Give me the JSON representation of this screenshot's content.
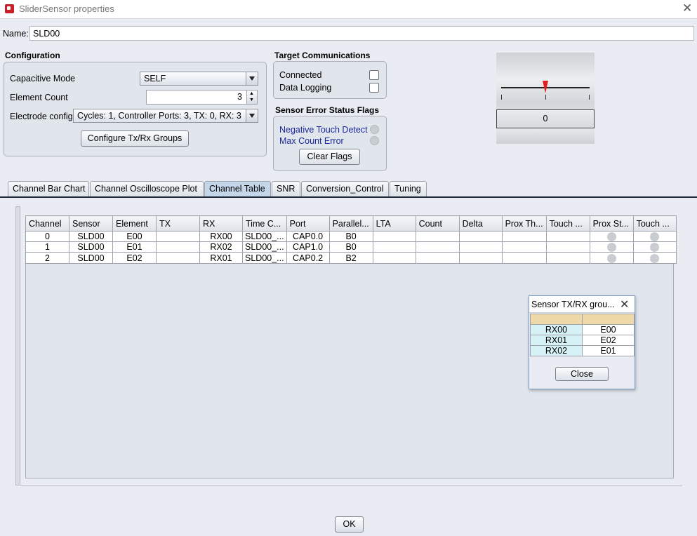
{
  "window": {
    "title": "SliderSensor properties"
  },
  "name_row": {
    "label": "Name:",
    "value": "SLD00"
  },
  "configuration": {
    "title": "Configuration",
    "capacitive_mode_label": "Capacitive Mode",
    "capacitive_mode_value": "SELF",
    "element_count_label": "Element Count",
    "element_count_value": "3",
    "electrode_config_label": "Electrode config",
    "electrode_config_value": "Cycles:  1, Controller Ports:  3, TX:  0, RX:  3",
    "configure_button": "Configure Tx/Rx Groups"
  },
  "target_comms": {
    "title": "Target Communications",
    "connected_label": "Connected",
    "connected_checked": false,
    "data_logging_label": "Data Logging",
    "data_logging_checked": false
  },
  "error_flags": {
    "title": "Sensor Error Status Flags",
    "negative_touch_label": "Negative Touch Detect",
    "max_count_label": "Max Count Error",
    "clear_button": "Clear Flags"
  },
  "slider_preview": {
    "value": "0",
    "position_fraction": 0.5
  },
  "tabs": [
    "Channel Bar Chart",
    "Channel Oscilloscope Plot",
    "Channel Table",
    "SNR",
    "Conversion_Control",
    "Tuning"
  ],
  "active_tab": "Channel Table",
  "channel_table": {
    "columns": [
      "Channel",
      "Sensor",
      "Element",
      "TX",
      "RX",
      "Time C...",
      "Port",
      "Parallel...",
      "LTA",
      "Count",
      "Delta",
      "Prox Th...",
      "Touch ...",
      "Prox St...",
      "Touch ..."
    ],
    "rows": [
      [
        "0",
        "SLD00",
        "E00",
        "",
        "RX00",
        "SLD00_...",
        "CAP0.0",
        "B0",
        "",
        "",
        "",
        "",
        "",
        "",
        ""
      ],
      [
        "1",
        "SLD00",
        "E01",
        "",
        "RX02",
        "SLD00_...",
        "CAP1.0",
        "B0",
        "",
        "",
        "",
        "",
        "",
        "",
        ""
      ],
      [
        "2",
        "SLD00",
        "E02",
        "",
        "RX01",
        "SLD00_...",
        "CAP0.2",
        "B2",
        "",
        "",
        "",
        "",
        "",
        "",
        ""
      ]
    ]
  },
  "popup": {
    "title": "Sensor TX/RX grou...",
    "rows": [
      [
        "RX00",
        "E00"
      ],
      [
        "RX01",
        "E02"
      ],
      [
        "RX02",
        "E01"
      ]
    ],
    "close_button": "Close"
  },
  "ok_button": "OK",
  "colors": {
    "accent_tab": "#c4d6ea",
    "label_blue": "#1a2a9a",
    "marker_red": "#e02020"
  }
}
